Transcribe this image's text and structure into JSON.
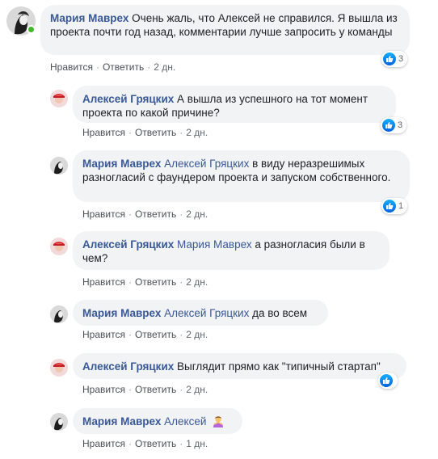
{
  "comments": [
    {
      "author": "Мария Маврех",
      "mention": "",
      "text": "Очень жаль, что Алексей не справился. Я вышла из проекта почти год назад, комментарии лучше запросить у команды",
      "like_label": "Нравится",
      "reply_label": "Ответить",
      "time": "2 дн.",
      "reactions": "3"
    },
    {
      "author": "Алексей Гряцких",
      "mention": "",
      "text": "А вышла из успешного на тот момент проекта по какой причине?",
      "like_label": "Нравится",
      "reply_label": "Ответить",
      "time": "2 дн.",
      "reactions": "3"
    },
    {
      "author": "Мария Маврех",
      "mention": "Алексей Гряцких",
      "text": "в виду неразрешимых разногласий с фаундером проекта и запуском собственного.",
      "like_label": "Нравится",
      "reply_label": "Ответить",
      "time": "2 дн.",
      "reactions": "1"
    },
    {
      "author": "Алексей Гряцких",
      "mention": "Мария Маврех",
      "text": "а разногласия были в чем?",
      "like_label": "Нравится",
      "reply_label": "Ответить",
      "time": "2 дн."
    },
    {
      "author": "Мария Маврех",
      "mention": "Алексей Гряцких",
      "text": "да во всем",
      "like_label": "Нравится",
      "reply_label": "Ответить",
      "time": "2 дн."
    },
    {
      "author": "Алексей Гряцких",
      "mention": "",
      "text": "Выглядит прямо как \"типичный стартап\"",
      "like_label": "Нравится",
      "reply_label": "Ответить",
      "time": "2 дн.",
      "reactions": ""
    },
    {
      "author": "Мария Маврех",
      "mention": "Алексей",
      "text": "",
      "emoji": "person-gesturing-no-emoji",
      "like_label": "Нравится",
      "reply_label": "Ответить",
      "time": "1 дн."
    }
  ],
  "colors": {
    "author": "#385898",
    "bubble": "#f2f3f5",
    "like_blue": "#1877f2",
    "online": "#42b72a"
  }
}
